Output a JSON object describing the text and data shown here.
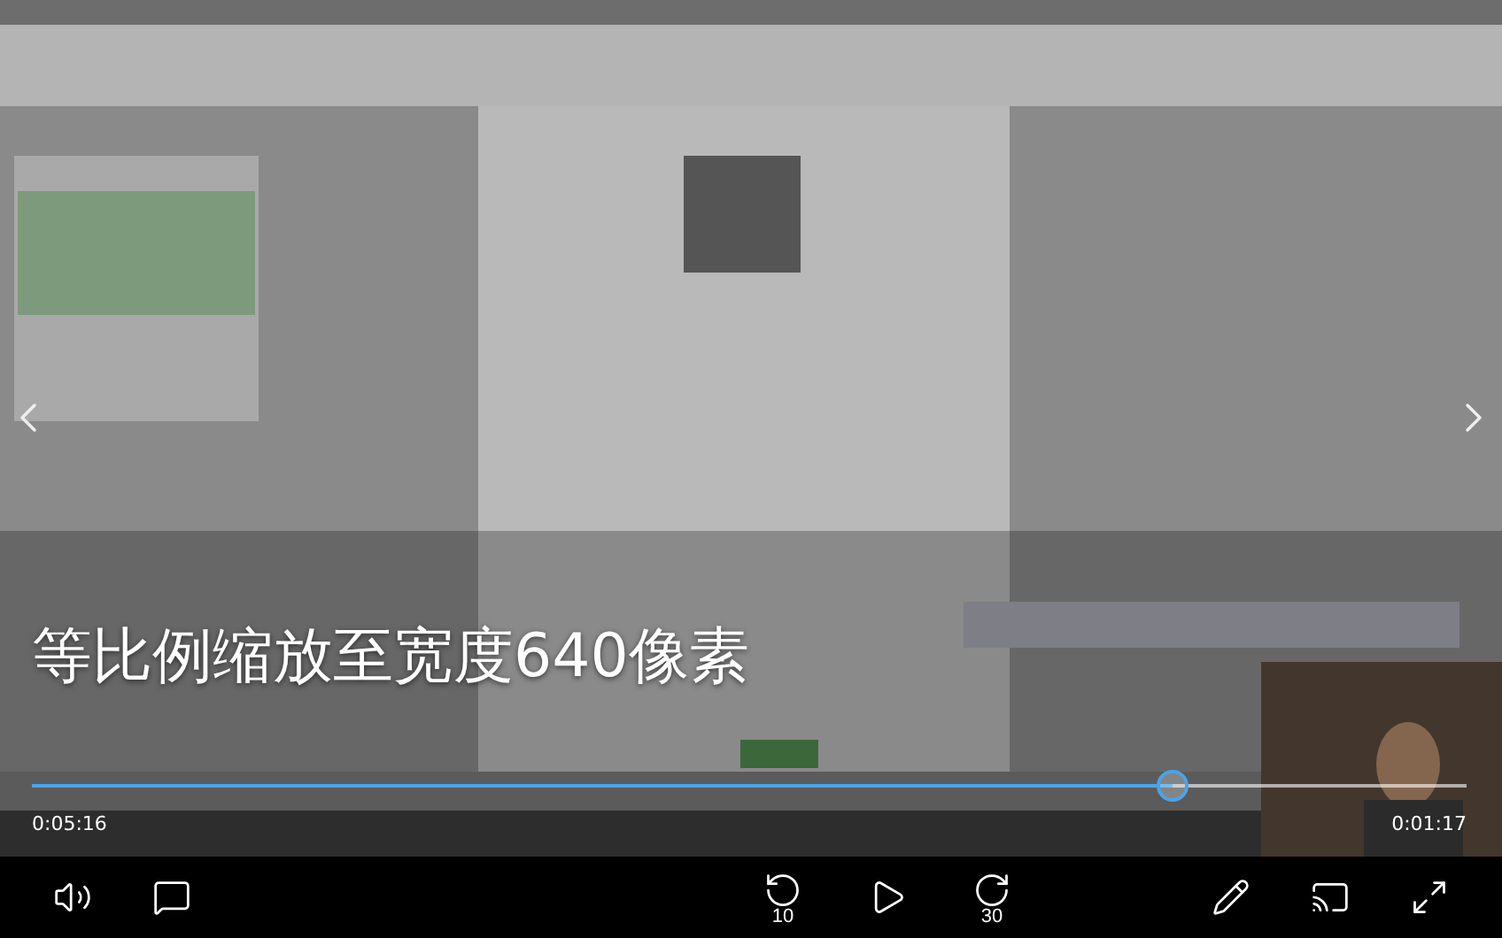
{
  "video": {
    "caption": "等比例缩放至宽度640像素"
  },
  "progress": {
    "level": 0.795,
    "elapsed": "0:05:16",
    "remaining": "0:01:17"
  },
  "controls": {
    "skip_back": "10",
    "skip_forward": "30"
  }
}
